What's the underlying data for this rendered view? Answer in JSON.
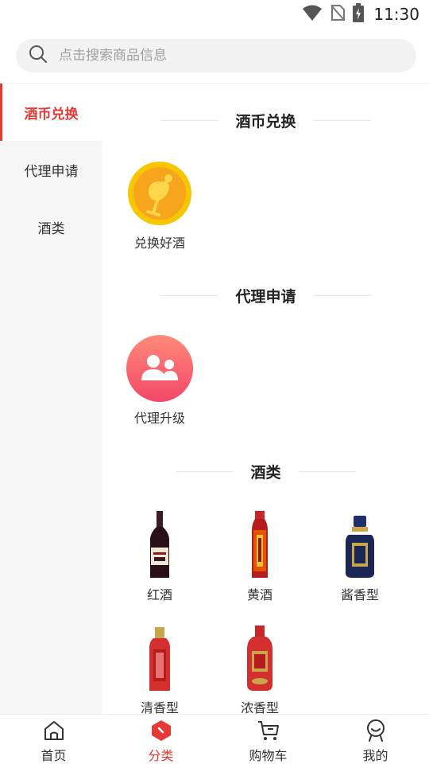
{
  "status_bar": {
    "time": "11:30"
  },
  "search": {
    "placeholder": "点击搜索商品信息"
  },
  "sidebar": {
    "items": [
      {
        "label": "酒币兑换",
        "active": true
      },
      {
        "label": "代理申请",
        "active": false
      },
      {
        "label": "酒类",
        "active": false
      }
    ]
  },
  "sections": {
    "exchange": {
      "title": "酒币兑换",
      "items": [
        {
          "label": "兑换好酒",
          "icon": "coin-icon"
        }
      ]
    },
    "agent": {
      "title": "代理申请",
      "items": [
        {
          "label": "代理升级",
          "icon": "users-icon"
        }
      ]
    },
    "liquor": {
      "title": "酒类",
      "items": [
        {
          "label": "红酒",
          "icon": "red-wine-bottle"
        },
        {
          "label": "黄酒",
          "icon": "yellow-wine-bottle"
        },
        {
          "label": "酱香型",
          "icon": "sauce-aroma-bottle"
        },
        {
          "label": "清香型",
          "icon": "light-aroma-bottle"
        },
        {
          "label": "浓香型",
          "icon": "strong-aroma-bottle"
        }
      ]
    }
  },
  "bottom_nav": {
    "items": [
      {
        "label": "首页",
        "icon": "home-icon",
        "active": false
      },
      {
        "label": "分类",
        "icon": "category-icon",
        "active": true
      },
      {
        "label": "购物车",
        "icon": "cart-icon",
        "active": false
      },
      {
        "label": "我的",
        "icon": "profile-icon",
        "active": false
      }
    ]
  },
  "colors": {
    "accent": "#e53935",
    "sidebar_bg": "#f5f5f5",
    "search_bg": "#f2f2f2"
  }
}
